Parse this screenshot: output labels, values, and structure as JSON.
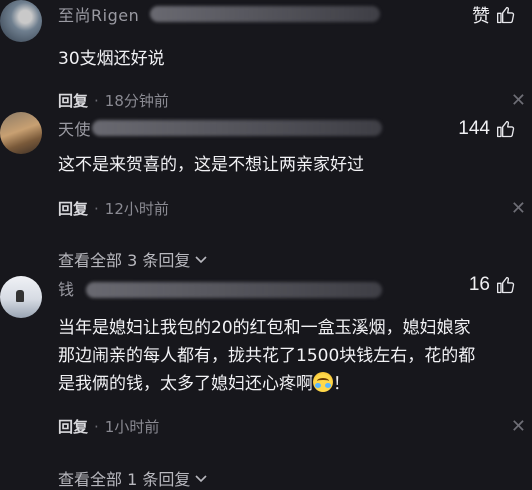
{
  "comments": [
    {
      "name": "至尚Rigen",
      "like_label": "赞",
      "text": "30支烟还好说",
      "reply_label": "回复",
      "time": "18分钟前",
      "close_glyph": "✕"
    },
    {
      "name": "天使",
      "like_count": "144",
      "text": "这不是来贺喜的，这是不想让两亲家好过",
      "reply_label": "回复",
      "time": "12小时前",
      "close_glyph": "✕",
      "view_all": "查看全部 3 条回复"
    },
    {
      "name": "钱",
      "like_count": "16",
      "text_lines": [
        "当年是媳妇让我包的20的红包和一盒玉溪烟，媳妇娘家",
        "那边闹亲的每人都有，拢共花了1500块钱左右，花的都",
        "是我俩的钱，太多了媳妇还心疼啊"
      ],
      "text_tail": "！",
      "reply_label": "回复",
      "time": "1小时前",
      "close_glyph": "✕",
      "view_all": "查看全部 1 条回复"
    }
  ],
  "icons": {
    "thumb": "thumbs-up-icon",
    "chevron": "chevron-down-icon",
    "emoji": "crying-laughing-emoji-icon"
  }
}
